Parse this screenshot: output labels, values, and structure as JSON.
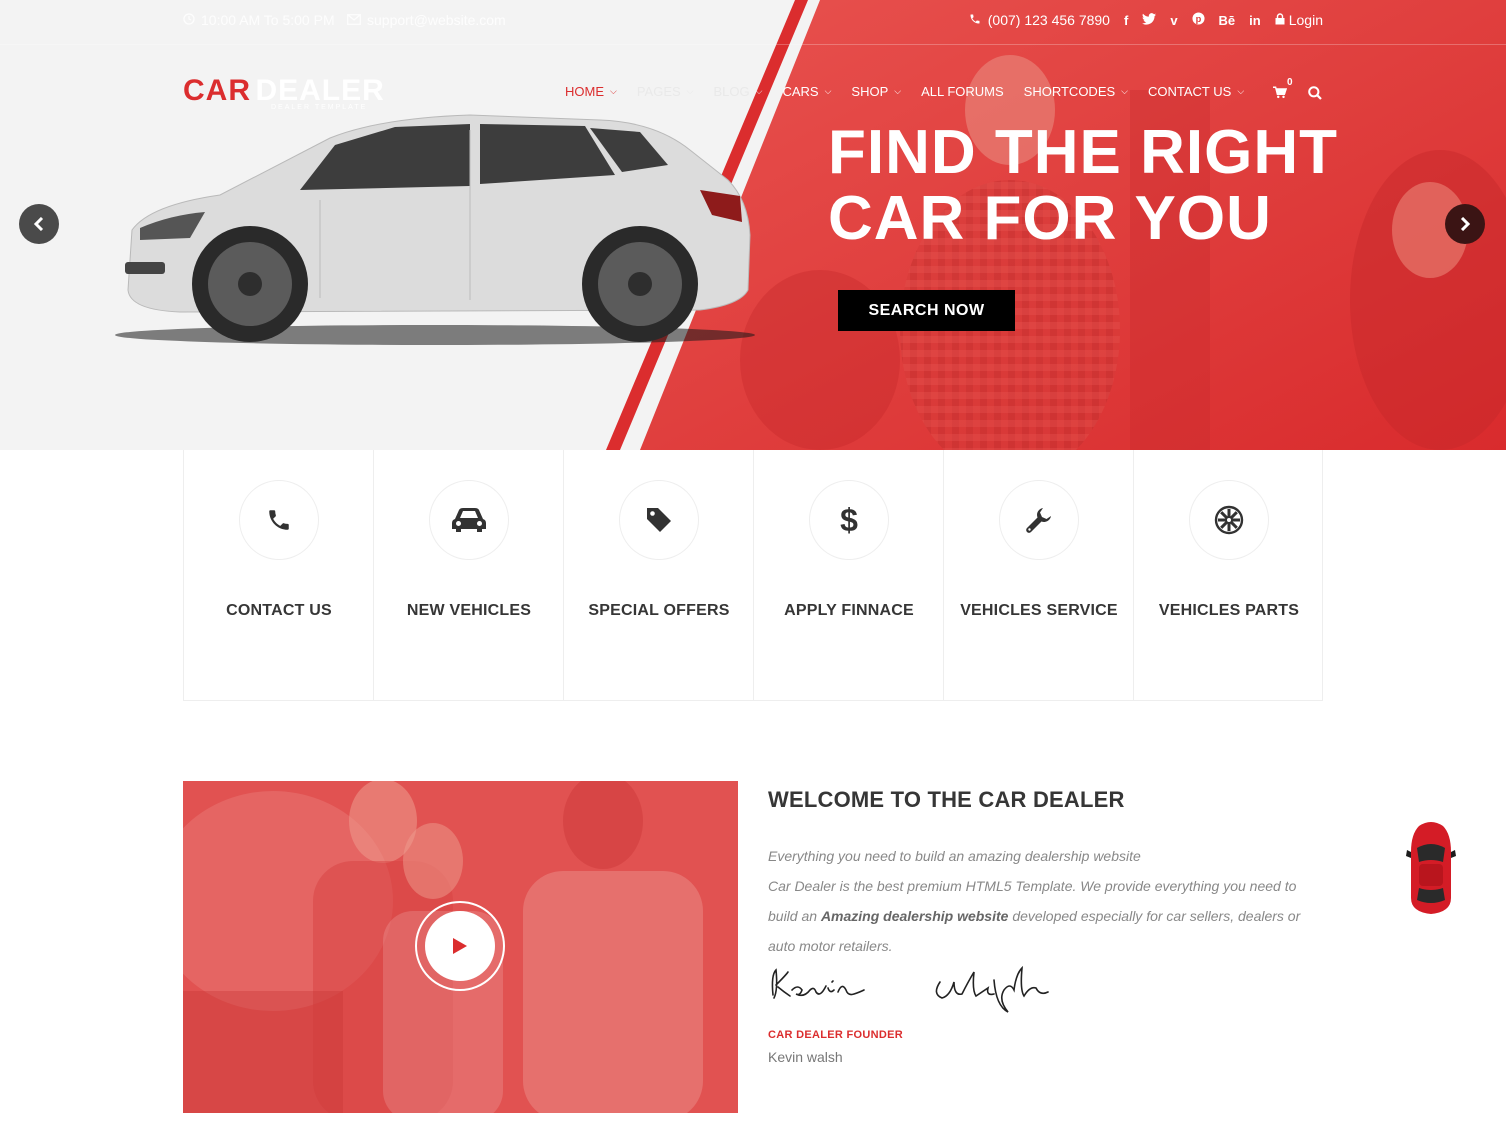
{
  "topbar": {
    "hours": "10:00 AM To 5:00 PM",
    "email": "support@website.com",
    "phone": "(007) 123 456 7890",
    "social": [
      "facebook-icon",
      "twitter-icon",
      "vimeo-icon",
      "pinterest-icon",
      "behance-icon",
      "linkedin-icon"
    ],
    "behance_text": "Bē",
    "linkedin_text": "in",
    "login": "Login"
  },
  "logo": {
    "car": "CAR",
    "dealer": "DEALER",
    "tagline": "DEALER TEMPLATE"
  },
  "nav": [
    {
      "label": "HOME",
      "active": true,
      "dropdown": true
    },
    {
      "label": "PAGES",
      "active": false,
      "dropdown": true
    },
    {
      "label": "BLOG",
      "active": false,
      "dropdown": true
    },
    {
      "label": "CARS",
      "active": false,
      "dropdown": true
    },
    {
      "label": "SHOP",
      "active": false,
      "dropdown": true
    },
    {
      "label": "ALL FORUMS",
      "active": false,
      "dropdown": false
    },
    {
      "label": "SHORTCODES",
      "active": false,
      "dropdown": true
    },
    {
      "label": "CONTACT US",
      "active": false,
      "dropdown": true
    }
  ],
  "cart": {
    "count": "0"
  },
  "hero": {
    "title_line1": "FIND THE RIGHT",
    "title_line2": "CAR FOR YOU",
    "button": "SEARCH NOW"
  },
  "features": [
    {
      "label": "CONTACT US",
      "icon": "phone-icon"
    },
    {
      "label": "NEW VEHICLES",
      "icon": "car-icon"
    },
    {
      "label": "SPECIAL OFFERS",
      "icon": "tag-icon"
    },
    {
      "label": "APPLY FINNACE",
      "icon": "dollar-icon"
    },
    {
      "label": "VEHICLES SERVICE",
      "icon": "wrench-icon"
    },
    {
      "label": "VEHICLES PARTS",
      "icon": "gear-icon"
    }
  ],
  "welcome": {
    "title": "WELCOME TO THE CAR DEALER",
    "intro": "Everything you need to build an amazing dealership website",
    "body_1": "Car Dealer is the best premium HTML5 Template. We provide everything you need to build an ",
    "body_bold": "Amazing dealership website",
    "body_2": " developed especially for car sellers, dealers or auto motor retailers.",
    "signature": "Kevin Walsh",
    "role": "CAR DEALER FOUNDER",
    "name": "Kevin walsh"
  },
  "colors": {
    "accent": "#db2d2e",
    "dark": "#363636",
    "text_muted": "#888888"
  }
}
